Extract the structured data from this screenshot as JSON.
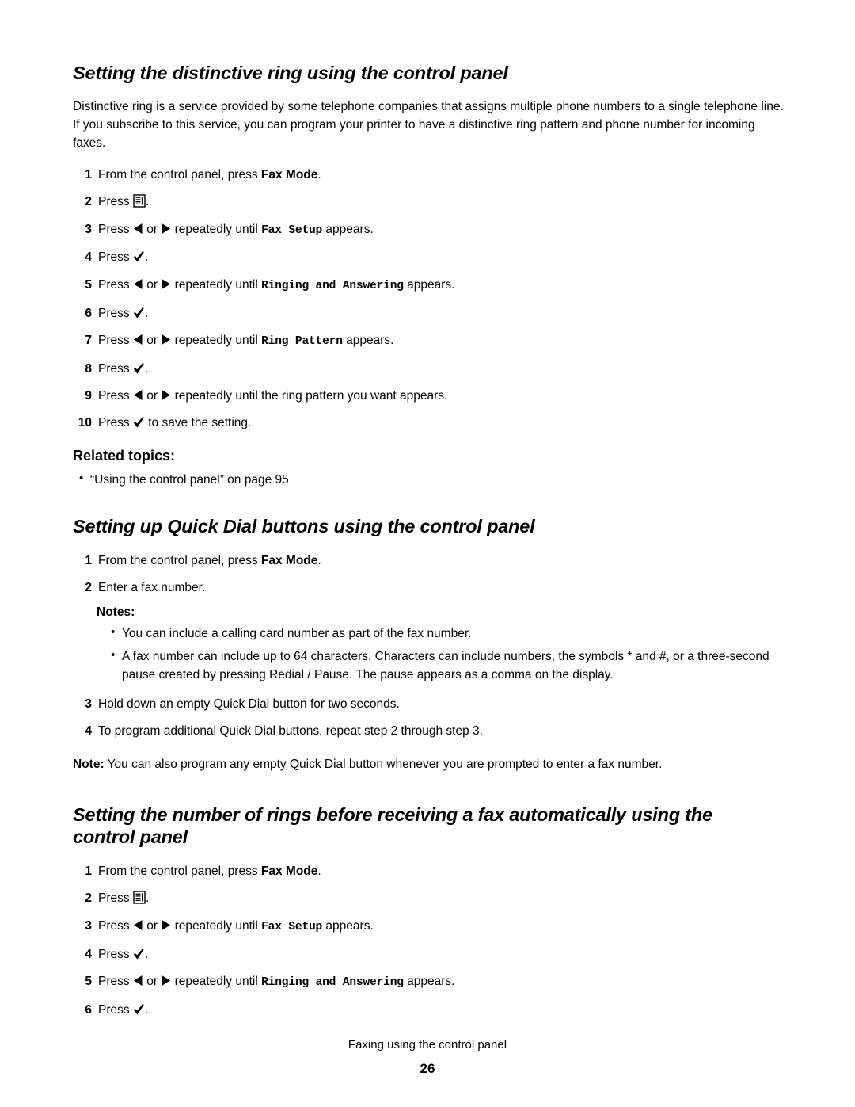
{
  "sections": [
    {
      "title": "Setting the distinctive ring using the control panel",
      "intro": "Distinctive ring is a service provided by some telephone companies that assigns multiple phone numbers to a single telephone line. If you subscribe to this service, you can program your printer to have a distinctive ring pattern and phone number for incoming faxes.",
      "steps": [
        {
          "num": "1",
          "pre": "From the control panel, press ",
          "bold": "Fax Mode",
          "post": "."
        },
        {
          "num": "2",
          "pre": "Press ",
          "icon": "menu-icon",
          "post": "."
        },
        {
          "num": "3",
          "pre": "Press ",
          "icon": "left-arrow-icon",
          "mid": " or ",
          "icon2": "right-arrow-icon",
          "mid2": " repeatedly until ",
          "mono": "Fax Setup",
          "post": " appears."
        },
        {
          "num": "4",
          "pre": "Press ",
          "icon": "check-icon",
          "post": "."
        },
        {
          "num": "5",
          "pre": "Press ",
          "icon": "left-arrow-icon",
          "mid": " or ",
          "icon2": "right-arrow-icon",
          "mid2": " repeatedly until ",
          "mono": "Ringing and Answering",
          "post": " appears."
        },
        {
          "num": "6",
          "pre": "Press ",
          "icon": "check-icon",
          "post": "."
        },
        {
          "num": "7",
          "pre": "Press ",
          "icon": "left-arrow-icon",
          "mid": " or ",
          "icon2": "right-arrow-icon",
          "mid2": " repeatedly until ",
          "mono": "Ring Pattern",
          "post": " appears."
        },
        {
          "num": "8",
          "pre": "Press ",
          "icon": "check-icon",
          "post": "."
        },
        {
          "num": "9",
          "pre": "Press ",
          "icon": "left-arrow-icon",
          "mid": " or ",
          "icon2": "right-arrow-icon",
          "mid2": " repeatedly until the ring pattern you want appears.",
          "post": ""
        },
        {
          "num": "10",
          "pre": "Press ",
          "icon": "check-icon",
          "post": " to save the setting."
        }
      ],
      "related_label": "Related topics:",
      "related_items": [
        "“Using the control panel” on page 95"
      ]
    },
    {
      "title": "Setting up Quick Dial buttons using the control panel",
      "steps": [
        {
          "num": "1",
          "pre": "From the control panel, press ",
          "bold": "Fax Mode",
          "post": "."
        },
        {
          "num": "2",
          "pre": "Enter a fax number.",
          "post": ""
        }
      ],
      "notes_label": "Notes:",
      "notes": [
        "You can include a calling card number as part of the fax number.",
        "A fax number can include up to 64 characters. Characters can include numbers, the symbols * and #, or a three-second pause created by pressing Redial / Pause. The pause appears as a comma on the display."
      ],
      "steps_after": [
        {
          "num": "3",
          "pre": "Hold down an empty Quick Dial button for two seconds.",
          "post": ""
        },
        {
          "num": "4",
          "pre": "To program additional Quick Dial buttons, repeat step 2 through step 3.",
          "post": ""
        }
      ],
      "note_bold": "Note:",
      "note_text": " You can also program any empty Quick Dial button whenever you are prompted to enter a fax number."
    },
    {
      "title": "Setting the number of rings before receiving a fax automatically using the control panel",
      "steps": [
        {
          "num": "1",
          "pre": "From the control panel, press ",
          "bold": "Fax Mode",
          "post": "."
        },
        {
          "num": "2",
          "pre": "Press ",
          "icon": "menu-icon",
          "post": "."
        },
        {
          "num": "3",
          "pre": "Press ",
          "icon": "left-arrow-icon",
          "mid": " or ",
          "icon2": "right-arrow-icon",
          "mid2": " repeatedly until ",
          "mono": "Fax Setup",
          "post": " appears."
        },
        {
          "num": "4",
          "pre": "Press ",
          "icon": "check-icon",
          "post": "."
        },
        {
          "num": "5",
          "pre": "Press ",
          "icon": "left-arrow-icon",
          "mid": " or ",
          "icon2": "right-arrow-icon",
          "mid2": " repeatedly until ",
          "mono": "Ringing and Answering",
          "post": " appears."
        },
        {
          "num": "6",
          "pre": "Press ",
          "icon": "check-icon",
          "post": "."
        }
      ]
    }
  ],
  "footer": {
    "text": "Faxing using the control panel",
    "page": "26"
  }
}
